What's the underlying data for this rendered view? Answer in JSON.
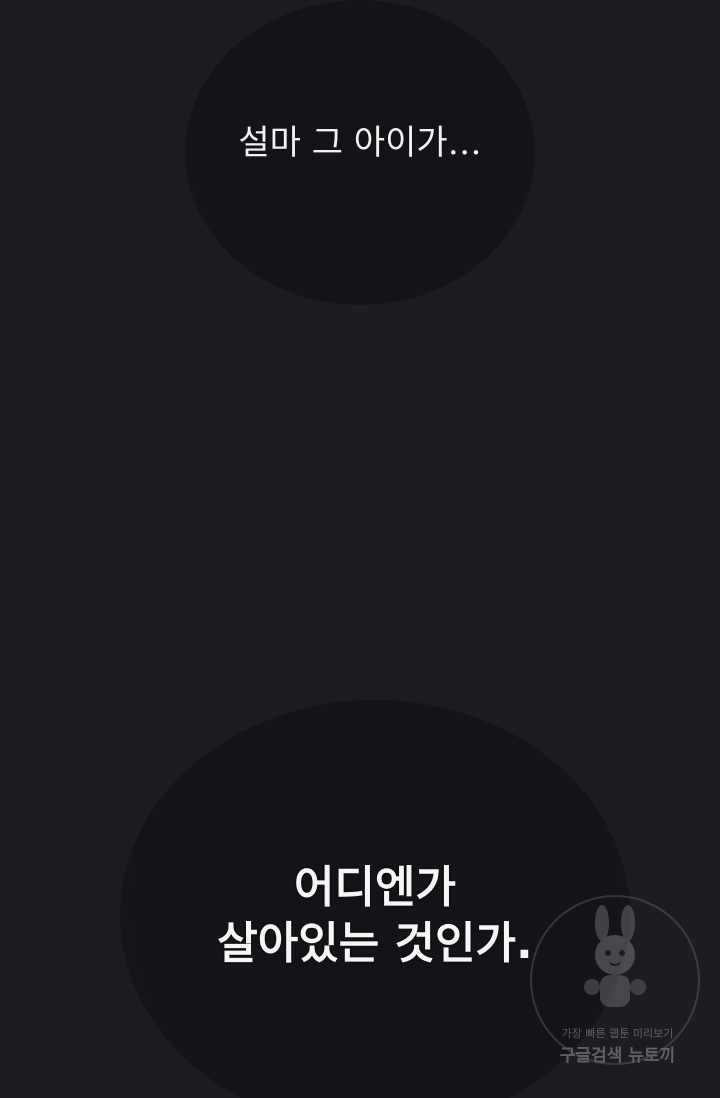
{
  "panel": {
    "background_color": "#1c1d22",
    "bubbles": [
      {
        "text": "설마 그 아이가…"
      },
      {
        "lines": [
          "어디엔가",
          "살아있는 것인가."
        ]
      }
    ]
  },
  "watermark": {
    "line1": "가장 빠른 웹툰 미리보기",
    "line2": "구글검색 뉴토끼",
    "icon": "rabbit-mascot-logo"
  }
}
